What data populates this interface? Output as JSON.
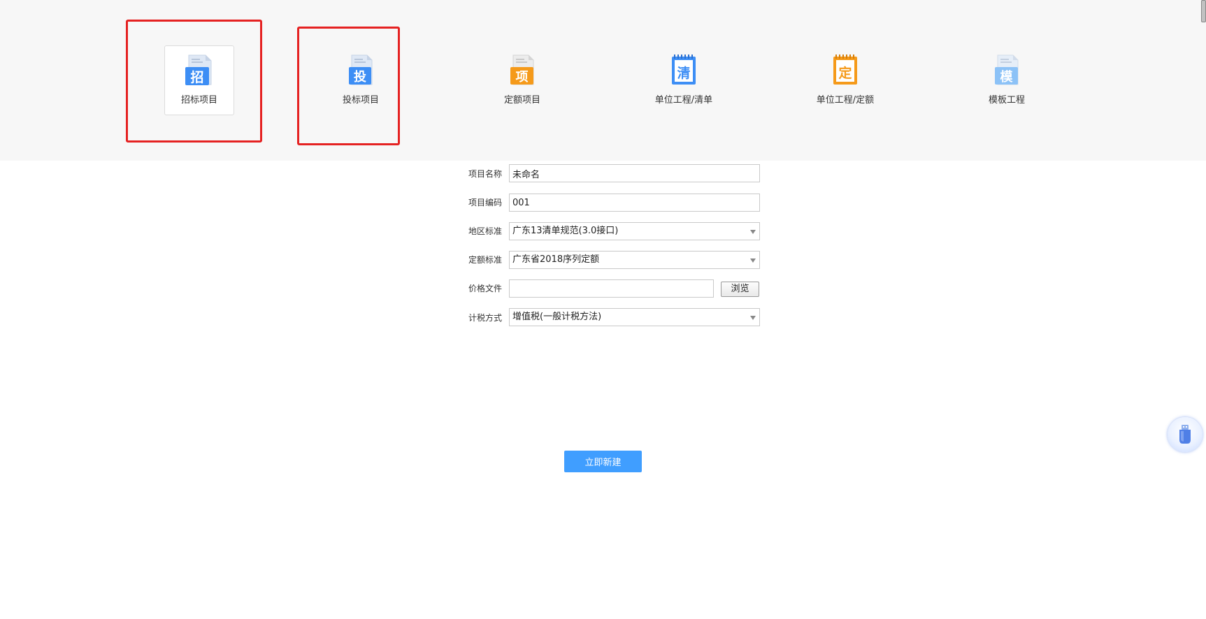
{
  "project_types": [
    {
      "label": "招标项目",
      "glyph": "招",
      "color": "#3d8ef5",
      "selected": true
    },
    {
      "label": "投标项目",
      "glyph": "投",
      "color": "#3d8ef5",
      "selected": false
    },
    {
      "label": "定额项目",
      "glyph": "项",
      "color": "#f59a1a",
      "selected": false
    },
    {
      "label": "单位工程/清单",
      "glyph": "清",
      "color": "#3d8ef5",
      "selected": false
    },
    {
      "label": "单位工程/定额",
      "glyph": "定",
      "color": "#f59a1a",
      "selected": false
    },
    {
      "label": "模板工程",
      "glyph": "模",
      "color": "#8cc2f7",
      "selected": false
    }
  ],
  "form": {
    "name_label": "项目名称",
    "name_value": "未命名",
    "code_label": "项目编码",
    "code_value": "001",
    "region_label": "地区标准",
    "region_value": "广东13清单规范(3.0接口)",
    "quota_label": "定额标准",
    "quota_value": "广东省2018序列定额",
    "price_label": "价格文件",
    "price_value": "",
    "browse_label": "浏览",
    "tax_label": "计税方式",
    "tax_value": "增值税(一般计税方法)"
  },
  "create_button_label": "立即新建",
  "colors": {
    "accent": "#409eff",
    "highlight": "#e52222",
    "band": "#f7f7f7"
  },
  "icons": [
    "document-icon",
    "usb-drive-icon"
  ]
}
